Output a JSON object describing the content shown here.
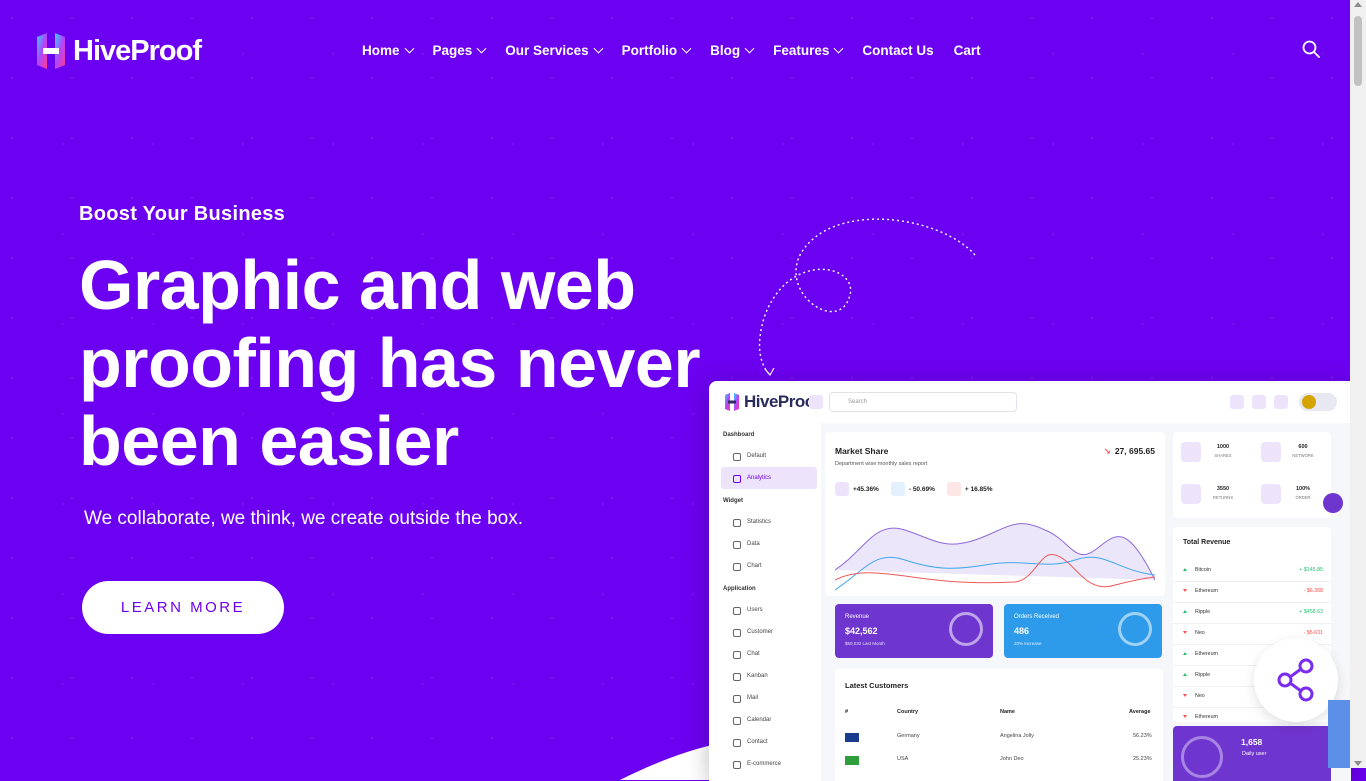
{
  "brand": {
    "name": "HiveProof"
  },
  "nav": [
    {
      "label": "Home",
      "dropdown": true
    },
    {
      "label": "Pages",
      "dropdown": true
    },
    {
      "label": "Our Services",
      "dropdown": true
    },
    {
      "label": "Portfolio",
      "dropdown": true
    },
    {
      "label": "Blog",
      "dropdown": true
    },
    {
      "label": "Features",
      "dropdown": true
    },
    {
      "label": "Contact Us",
      "dropdown": false
    },
    {
      "label": "Cart",
      "dropdown": false
    }
  ],
  "hero": {
    "eyebrow": "Boost Your Business",
    "headline": "Graphic and web proofing has never been easier",
    "subtext": "We collaborate, we think, we create outside the box.",
    "cta": "LEARN MORE"
  },
  "dashboard": {
    "brand": "HiveProof",
    "search_placeholder": "Search",
    "sidebar": {
      "sections": [
        {
          "title": "Dashboard",
          "items": [
            "Default",
            "Analytics"
          ]
        },
        {
          "title": "Widget",
          "items": [
            "Statistics",
            "Data",
            "Chart"
          ]
        },
        {
          "title": "Application",
          "items": [
            "Users",
            "Customer",
            "Chat",
            "Kanban",
            "Mail",
            "Calendar",
            "Contact",
            "E-commerce"
          ]
        }
      ],
      "active": "Analytics"
    },
    "market_share": {
      "title": "Market Share",
      "subtitle": "Department wise monthly sales report",
      "value": "27, 695.65",
      "stats": [
        {
          "icon": "facebook-icon",
          "value": "+45.36%"
        },
        {
          "icon": "twitter-icon",
          "value": "- 50.69%"
        },
        {
          "icon": "youtube-icon",
          "value": "+ 16.85%"
        }
      ]
    },
    "revenue": {
      "title": "Revenue",
      "value": "$42,562",
      "sub": "$50,032 Last Month"
    },
    "orders": {
      "title": "Orders Received",
      "value": "486",
      "sub": "20% Increase"
    },
    "latest_customers": {
      "title": "Latest Customers",
      "columns": [
        "#",
        "Country",
        "Name",
        "Average"
      ],
      "rows": [
        {
          "country": "Germany",
          "name": "Angelina Jolly",
          "average": "56.23%"
        },
        {
          "country": "USA",
          "name": "John Deo",
          "average": "25.23%"
        }
      ]
    },
    "kpis": [
      {
        "value": "1000",
        "label": "SHARES"
      },
      {
        "value": "600",
        "label": "NETWORK"
      },
      {
        "value": "3550",
        "label": "RETURNS"
      },
      {
        "value": "100%",
        "label": "ORDER"
      }
    ],
    "total_revenue": {
      "title": "Total Revenue",
      "rows": [
        {
          "name": "Bitcoin",
          "amount": "+ $145.85",
          "dir": "up"
        },
        {
          "name": "Ethereum",
          "amount": "- $6.368",
          "dir": "down"
        },
        {
          "name": "Ripple",
          "amount": "+ $458.63",
          "dir": "up"
        },
        {
          "name": "Neo",
          "amount": "- $5.631",
          "dir": "down"
        },
        {
          "name": "Ethereum",
          "amount": "",
          "dir": "up"
        },
        {
          "name": "Ripple",
          "amount": "",
          "dir": "up"
        },
        {
          "name": "Neo",
          "amount": "",
          "dir": "down"
        },
        {
          "name": "Ethereum",
          "amount": "",
          "dir": "down"
        }
      ]
    },
    "daily": {
      "value": "1,658",
      "label": "Daily user"
    }
  }
}
